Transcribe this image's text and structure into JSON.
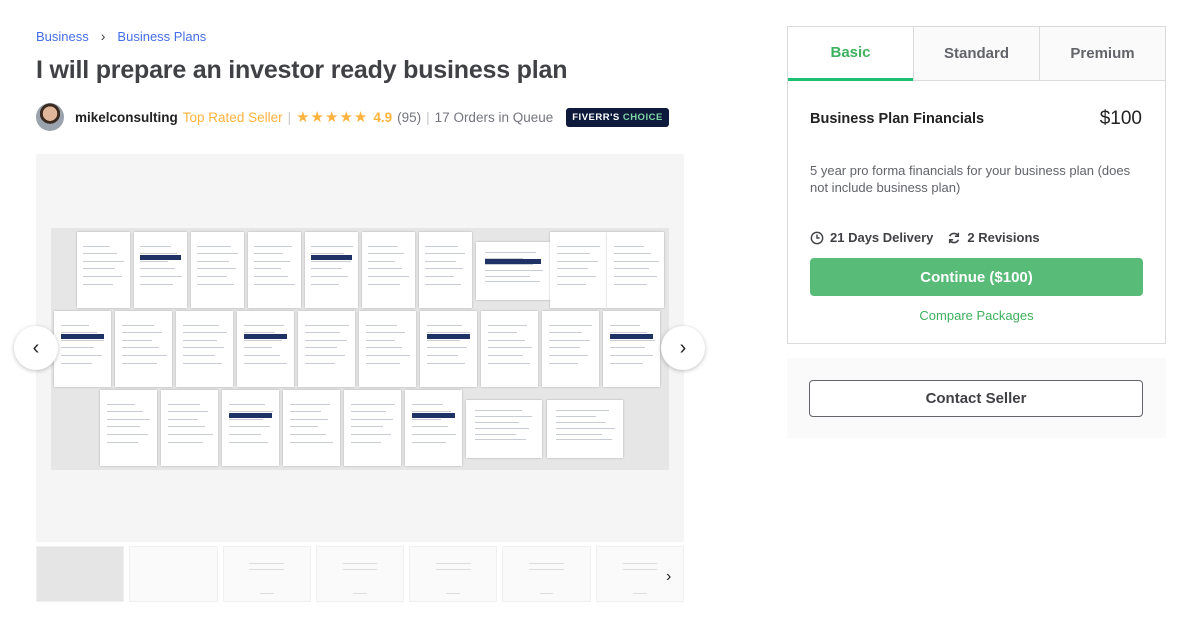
{
  "breadcrumb": [
    "Business",
    "Business Plans"
  ],
  "title": "I will prepare an investor ready business plan",
  "seller": {
    "name": "mikelconsulting",
    "level": "Top Rated Seller",
    "stars": "★★★★★",
    "rating": "4.9",
    "reviews": "(95)",
    "queue": "17 Orders in Queue",
    "badge_a": "FIVERR'S ",
    "badge_b": "CHOICE"
  },
  "gallery": {
    "prev": "‹",
    "next": "›",
    "thumb_next": "›"
  },
  "package": {
    "tabs": [
      "Basic",
      "Standard",
      "Premium"
    ],
    "active_tab": "Basic",
    "name": "Business Plan Financials",
    "price": "$100",
    "description": "5 year pro forma financials for your business plan (does not include business plan)",
    "delivery": "21 Days Delivery",
    "revisions": "2 Revisions",
    "continue": "Continue ($100)",
    "compare": "Compare Packages"
  },
  "contact": "Contact Seller",
  "colors": {
    "accent": "#1dbf73",
    "button": "#58bb78",
    "link": "#446ee7",
    "star": "#ffb33e",
    "badge": "#0e1a3b"
  }
}
